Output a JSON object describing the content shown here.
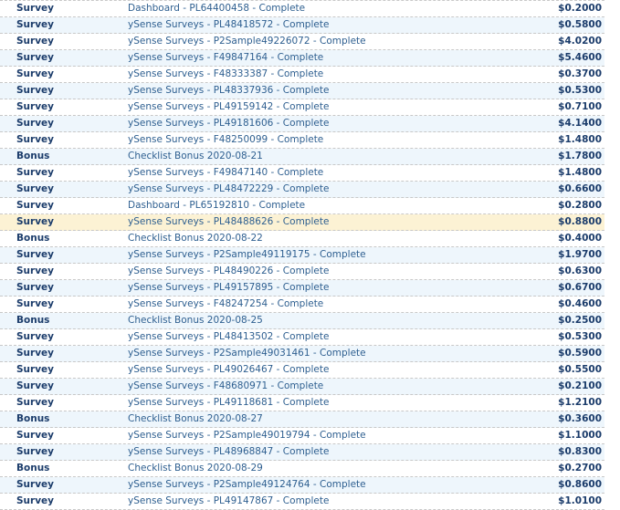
{
  "transactions": [
    {
      "type": "Survey",
      "description": "Dashboard - PL64400458 - Complete",
      "amount": "$0.2000"
    },
    {
      "type": "Survey",
      "description": "ySense Surveys - PL48418572 - Complete",
      "amount": "$0.5800"
    },
    {
      "type": "Survey",
      "description": "ySense Surveys - P2Sample49226072 - Complete",
      "amount": "$4.0200"
    },
    {
      "type": "Survey",
      "description": "ySense Surveys - F49847164 - Complete",
      "amount": "$5.4600"
    },
    {
      "type": "Survey",
      "description": "ySense Surveys - F48333387 - Complete",
      "amount": "$0.3700"
    },
    {
      "type": "Survey",
      "description": "ySense Surveys - PL48337936 - Complete",
      "amount": "$0.5300"
    },
    {
      "type": "Survey",
      "description": "ySense Surveys - PL49159142 - Complete",
      "amount": "$0.7100"
    },
    {
      "type": "Survey",
      "description": "ySense Surveys - PL49181606 - Complete",
      "amount": "$4.1400"
    },
    {
      "type": "Survey",
      "description": "ySense Surveys - F48250099 - Complete",
      "amount": "$1.4800"
    },
    {
      "type": "Bonus",
      "description": "Checklist Bonus 2020-08-21",
      "amount": "$1.7800"
    },
    {
      "type": "Survey",
      "description": "ySense Surveys - F49847140 - Complete",
      "amount": "$1.4800"
    },
    {
      "type": "Survey",
      "description": "ySense Surveys - PL48472229 - Complete",
      "amount": "$0.6600"
    },
    {
      "type": "Survey",
      "description": "Dashboard - PL65192810 - Complete",
      "amount": "$0.2800"
    },
    {
      "type": "Survey",
      "description": "ySense Surveys - PL48488626 - Complete",
      "amount": "$0.8800",
      "highlighted": true
    },
    {
      "type": "Bonus",
      "description": "Checklist Bonus 2020-08-22",
      "amount": "$0.4000"
    },
    {
      "type": "Survey",
      "description": "ySense Surveys - P2Sample49119175 - Complete",
      "amount": "$1.9700"
    },
    {
      "type": "Survey",
      "description": "ySense Surveys - PL48490226 - Complete",
      "amount": "$0.6300"
    },
    {
      "type": "Survey",
      "description": "ySense Surveys - PL49157895 - Complete",
      "amount": "$0.6700"
    },
    {
      "type": "Survey",
      "description": "ySense Surveys - F48247254 - Complete",
      "amount": "$0.4600"
    },
    {
      "type": "Bonus",
      "description": "Checklist Bonus 2020-08-25",
      "amount": "$0.2500"
    },
    {
      "type": "Survey",
      "description": "ySense Surveys - PL48413502 - Complete",
      "amount": "$0.5300"
    },
    {
      "type": "Survey",
      "description": "ySense Surveys - P2Sample49031461 - Complete",
      "amount": "$0.5900"
    },
    {
      "type": "Survey",
      "description": "ySense Surveys - PL49026467 - Complete",
      "amount": "$0.5500"
    },
    {
      "type": "Survey",
      "description": "ySense Surveys - F48680971 - Complete",
      "amount": "$0.2100"
    },
    {
      "type": "Survey",
      "description": "ySense Surveys - PL49118681 - Complete",
      "amount": "$1.2100"
    },
    {
      "type": "Bonus",
      "description": "Checklist Bonus 2020-08-27",
      "amount": "$0.3600"
    },
    {
      "type": "Survey",
      "description": "ySense Surveys - P2Sample49019794 - Complete",
      "amount": "$1.1000"
    },
    {
      "type": "Survey",
      "description": "ySense Surveys - PL48968847 - Complete",
      "amount": "$0.8300"
    },
    {
      "type": "Bonus",
      "description": "Checklist Bonus 2020-08-29",
      "amount": "$0.2700"
    },
    {
      "type": "Survey",
      "description": "ySense Surveys - P2Sample49124764 - Complete",
      "amount": "$0.8600"
    },
    {
      "type": "Survey",
      "description": "ySense Surveys - PL49147867 - Complete",
      "amount": "$1.0100"
    }
  ]
}
